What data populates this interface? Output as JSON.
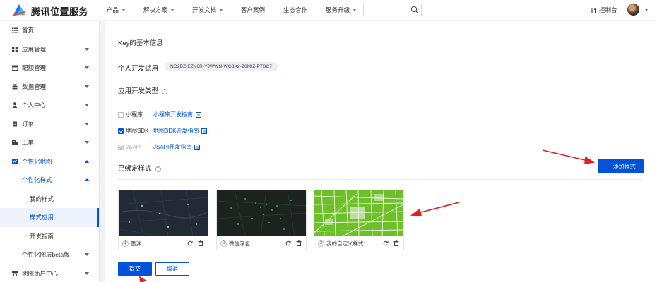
{
  "header": {
    "brand": "腾讯位置服务",
    "nav": [
      "产品",
      "解决方案",
      "开发文档",
      "客户案例",
      "生态合作",
      "服务升级"
    ],
    "nav_has_caret": [
      true,
      true,
      true,
      false,
      false,
      true
    ],
    "search_placeholder": "",
    "console_label": "控制台"
  },
  "sidebar": {
    "items": [
      {
        "label": "首页",
        "icon": "list-icon"
      },
      {
        "label": "应用管理",
        "icon": "grid-icon"
      },
      {
        "label": "配额管理",
        "icon": "quota-icon"
      },
      {
        "label": "数据管理",
        "icon": "database-icon"
      },
      {
        "label": "个人中心",
        "icon": "user-icon"
      },
      {
        "label": "订单",
        "icon": "order-icon"
      },
      {
        "label": "工单",
        "icon": "ticket-icon"
      },
      {
        "label": "个性化地图",
        "icon": "map-style-icon"
      },
      {
        "label": "个性化样式"
      },
      {
        "label": "我的样式"
      },
      {
        "label": "样式应用"
      },
      {
        "label": "开发指南"
      },
      {
        "label": "个性化图层beta版"
      },
      {
        "label": "地图商户中心",
        "icon": "shop-icon"
      }
    ]
  },
  "main": {
    "key_section_title": "Key的基本信息",
    "key_label": "个人开发试用",
    "key_value": "NO2BZ-EZY6R-YJWWN-WG3X2-Z6MIZ-PTBC7",
    "dev_type_title": "应用开发类型",
    "dev_types": [
      {
        "name": "小程序",
        "link": "小程序开发指南",
        "checked": false,
        "disabled": false
      },
      {
        "name": "地图SDK",
        "link": "地图SDK开发指南",
        "checked": true,
        "disabled": false
      },
      {
        "name": "JSAPI",
        "link": "JSAPI开发指南",
        "checked": true,
        "disabled": true
      }
    ],
    "bound_style_title": "已绑定样式",
    "add_style_label": "添加样式",
    "styles": [
      {
        "index": "1",
        "name": "墨渊",
        "theme": "dark"
      },
      {
        "index": "2",
        "name": "微信深色",
        "theme": "dark-green"
      },
      {
        "index": "3",
        "name": "我的自定义样式1",
        "theme": "green"
      }
    ],
    "submit_label": "提交",
    "cancel_label": "取消"
  },
  "colors": {
    "accent": "#0052d9",
    "annotation_arrow": "#e02020"
  }
}
